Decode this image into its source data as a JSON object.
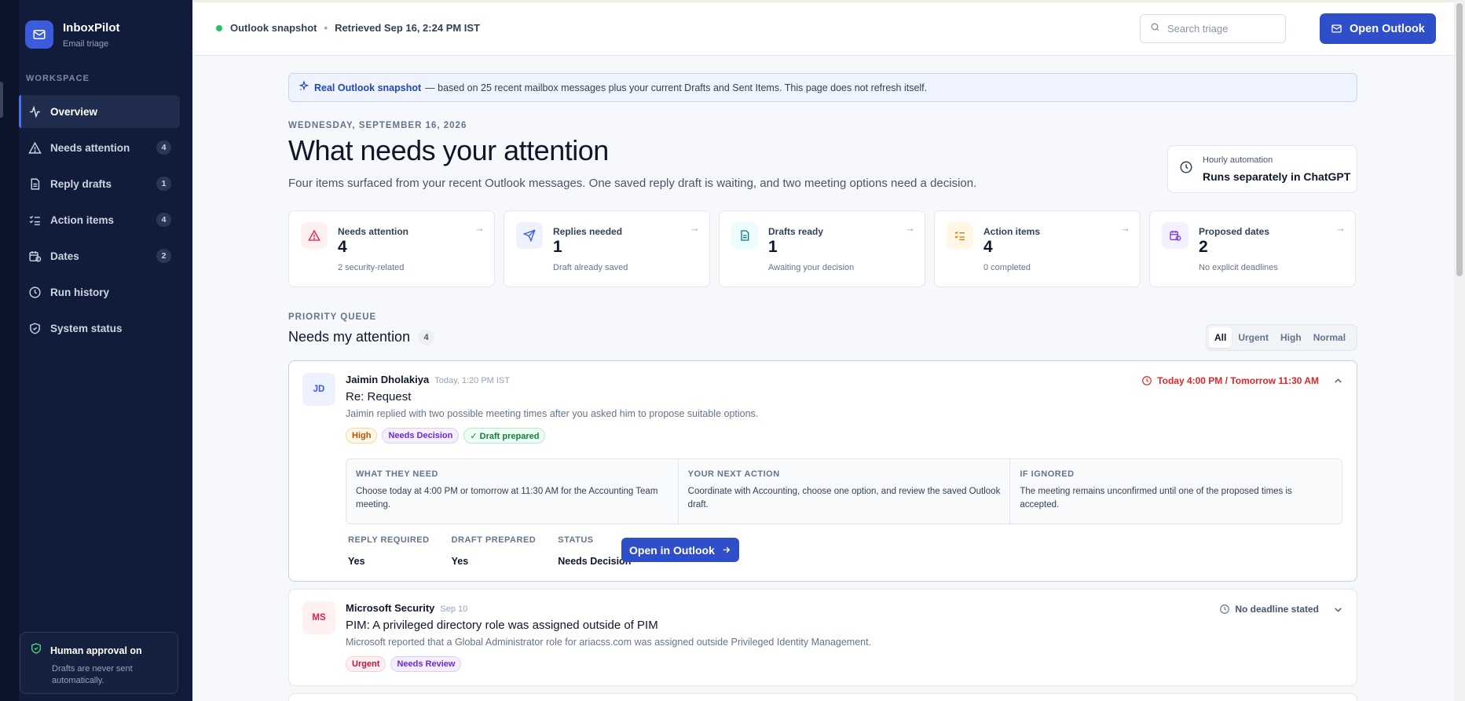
{
  "app": {
    "name": "InboxPilot",
    "tagline": "Email triage"
  },
  "sidebar": {
    "section_label": "WORKSPACE",
    "items": [
      {
        "label": "Overview",
        "icon": "activity-icon",
        "count": ""
      },
      {
        "label": "Needs attention",
        "icon": "warning-icon",
        "count": "4"
      },
      {
        "label": "Reply drafts",
        "icon": "document-icon",
        "count": "1"
      },
      {
        "label": "Action items",
        "icon": "checklist-icon",
        "count": "4"
      },
      {
        "label": "Dates",
        "icon": "calendar-icon",
        "count": "2"
      },
      {
        "label": "Run history",
        "icon": "history-icon",
        "count": ""
      },
      {
        "label": "System status",
        "icon": "shield-icon",
        "count": ""
      }
    ],
    "approval": {
      "title": "Human approval on",
      "subtitle": "Drafts are never sent automatically."
    }
  },
  "topbar": {
    "status": "Outlook snapshot",
    "separator": "•",
    "retrieved": "Retrieved Sep 16, 2:24 PM IST",
    "search_placeholder": "Search triage",
    "open_outlook": "Open Outlook"
  },
  "banner": {
    "highlight": "Real Outlook snapshot",
    "text": "— based on 25 recent mailbox messages plus your current Drafts and Sent Items. This page does not refresh itself."
  },
  "header": {
    "date": "WEDNESDAY, SEPTEMBER 16, 2026",
    "title": "What needs your attention",
    "subtitle": "Four items surfaced from your recent Outlook messages. One saved reply draft is waiting, and two meeting options need a decision."
  },
  "automation": {
    "label": "Hourly automation",
    "value": "Runs separately in ChatGPT"
  },
  "stats": [
    {
      "label": "Needs attention",
      "value": "4",
      "note": "2 security-related",
      "icon": "warning-icon"
    },
    {
      "label": "Replies needed",
      "value": "1",
      "note": "Draft already saved",
      "icon": "send-icon"
    },
    {
      "label": "Drafts ready",
      "value": "1",
      "note": "Awaiting your decision",
      "icon": "document-icon"
    },
    {
      "label": "Action items",
      "value": "4",
      "note": "0 completed",
      "icon": "checklist-icon"
    },
    {
      "label": "Proposed dates",
      "value": "2",
      "note": "No explicit deadlines",
      "icon": "calendar-clock-icon"
    }
  ],
  "queue": {
    "label": "PRIORITY QUEUE",
    "title": "Needs my attention",
    "count": "4",
    "filters": [
      "All",
      "Urgent",
      "High",
      "Normal"
    ],
    "active_filter": "All"
  },
  "messages": [
    {
      "initials": "JD",
      "sender": "Jaimin Dholakiya",
      "time": "Today, 1:20 PM IST",
      "subject": "Re: Request",
      "summary": "Jaimin replied with two possible meeting times after you asked him to propose suitable options.",
      "tags": [
        "High",
        "Needs Decision",
        "✓ Draft prepared"
      ],
      "due": "Today 4:00 PM / Tomorrow 11:30 AM",
      "expanded": true,
      "details": [
        {
          "head": "WHAT THEY NEED",
          "text": "Choose today at 4:00 PM or tomorrow at 11:30 AM for the Accounting Team meeting."
        },
        {
          "head": "YOUR NEXT ACTION",
          "text": "Coordinate with Accounting, choose one option, and review the saved Outlook draft."
        },
        {
          "head": "IF IGNORED",
          "text": "The meeting remains unconfirmed until one of the proposed times is accepted."
        }
      ],
      "meta": [
        {
          "head": "REPLY REQUIRED",
          "value": "Yes"
        },
        {
          "head": "DRAFT PREPARED",
          "value": "Yes"
        },
        {
          "head": "STATUS",
          "value": "Needs Decision"
        }
      ],
      "open_label": "Open in Outlook"
    },
    {
      "initials": "MS",
      "sender": "Microsoft Security",
      "time": "Sep 10",
      "subject": "PIM: A privileged directory role was assigned outside of PIM",
      "summary": "Microsoft reported that a Global Administrator role for ariacss.com was assigned outside Privileged Identity Management.",
      "tags": [
        "Urgent",
        "Needs Review"
      ],
      "due": "No deadline stated",
      "expanded": false
    }
  ],
  "colors": {
    "sidebar_bg": "#111c3a",
    "accent": "#2f4ec9",
    "danger": "#dc2626",
    "success": "#22c55e"
  }
}
